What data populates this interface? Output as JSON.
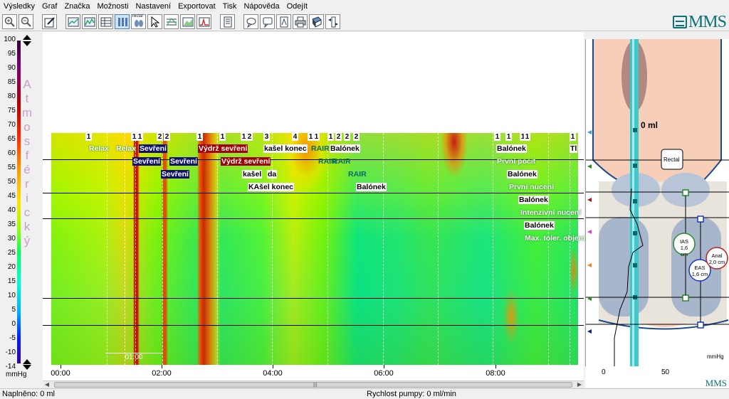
{
  "menu": [
    "Výsledky",
    "Graf",
    "Značka",
    "Možnosti",
    "Nastavení",
    "Exportovat",
    "Tisk",
    "Nápověda",
    "Odejít"
  ],
  "toolbar": {
    "rectal_label": "rectal",
    "icons": [
      "zoom-in-icon",
      "zoom-out-icon",
      "edit-icon",
      "line-chart-icon",
      "curve-chart-icon",
      "table-icon",
      "columns-icon",
      "rectal-icon",
      "cursor-icon",
      "lines-icon",
      "area-chart-icon",
      "signal-chart-icon",
      "notes-icon",
      "speech-bubble-icon",
      "comment-icon",
      "export-pdf-icon",
      "print-icon",
      "book-icon",
      "arrows-icon"
    ]
  },
  "logo": {
    "text": "MMS",
    "footer_text": "MMS"
  },
  "scale": {
    "ticks": [
      "100",
      "95",
      "90",
      "85",
      "80",
      "75",
      "70",
      "65",
      "60",
      "55",
      "50",
      "45",
      "40",
      "35",
      "30",
      "25",
      "20",
      "15",
      "10",
      "5",
      "0",
      "-5",
      "-10",
      "-14"
    ],
    "label_letters": [
      "A",
      "t",
      "m",
      "o",
      "s",
      "f",
      "é",
      "r",
      "i",
      "c",
      "k",
      "ý"
    ],
    "unit": "mmHg"
  },
  "chart_data": {
    "type": "heatmap",
    "x_ticks": [
      "00:00",
      "02:00",
      "04:00",
      "06:00",
      "08:00"
    ],
    "time_bar_label": "01:00",
    "color_scale_range": [
      -14,
      100
    ],
    "unit": "mmHg",
    "marker_numbers": [
      "1",
      "1",
      "1",
      "2",
      "2",
      "1",
      "1",
      "1",
      "2",
      "3",
      "4",
      "1",
      "1",
      "1",
      "2",
      "2",
      "2",
      "1",
      "1",
      "1",
      "1",
      "1"
    ],
    "events": [
      {
        "text": "Relax",
        "style": "green"
      },
      {
        "text": "Relax",
        "style": "green"
      },
      {
        "text": "Sevření",
        "style": "navy"
      },
      {
        "text": "Sevření",
        "style": "navy"
      },
      {
        "text": "Sevření",
        "style": "navy"
      },
      {
        "text": "Sevření",
        "style": "navy"
      },
      {
        "text": "Výdrž sevření",
        "style": "red"
      },
      {
        "text": "Výdrž sevření",
        "style": "red"
      },
      {
        "text": "kašel",
        "style": "white"
      },
      {
        "text": "da",
        "style": "white"
      },
      {
        "text": "KAšel konec",
        "style": "white"
      },
      {
        "text": "kašel konec",
        "style": "white"
      },
      {
        "text": "RAIR",
        "style": "cyan"
      },
      {
        "text": "Balónek",
        "style": "white"
      },
      {
        "text": "RAIR",
        "style": "cyan"
      },
      {
        "text": "RAIR",
        "style": "cyan"
      },
      {
        "text": "RAIR",
        "style": "cyan"
      },
      {
        "text": "Balónek",
        "style": "white"
      },
      {
        "text": "Balónek",
        "style": "white"
      },
      {
        "text": "První pocit",
        "style": "green"
      },
      {
        "text": "Balónek",
        "style": "white"
      },
      {
        "text": "První nucení",
        "style": "green"
      },
      {
        "text": "Balónek",
        "style": "white"
      },
      {
        "text": "Intenzivní nucení",
        "style": "green"
      },
      {
        "text": "Balónek",
        "style": "white"
      },
      {
        "text": "Max. toler. objem",
        "style": "green"
      },
      {
        "text": "Tl",
        "style": "white"
      }
    ]
  },
  "side_panel": {
    "volume": "0 ml",
    "rectal_label": "Rectal",
    "ias_label": "IAS",
    "ias_value": "1,6 cm",
    "eas_label": "EAS",
    "eas_value": "1,6 cm",
    "anal_label": "Anal",
    "anal_value": "2,0 cm",
    "x_ticks": [
      "0",
      "50"
    ],
    "unit": "mmHg"
  },
  "status": {
    "filled": "Naplněno: 0 ml",
    "pump_speed": "Rychlost pumpy: 0 ml/min"
  }
}
